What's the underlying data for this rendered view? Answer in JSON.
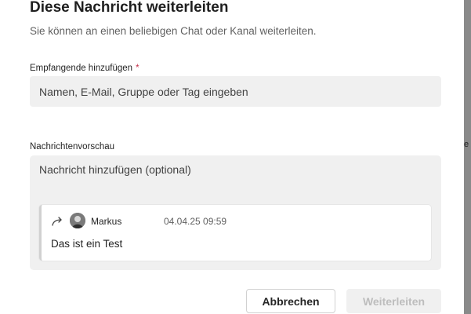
{
  "dialog": {
    "title": "Diese Nachricht weiterleiten",
    "subtitle": "Sie können an einen beliebigen Chat oder Kanal weiterleiten."
  },
  "recipients": {
    "label": "Empfangende hinzufügen",
    "required_marker": "*",
    "placeholder": "Namen, E-Mail, Gruppe oder Tag eingeben",
    "value": ""
  },
  "preview": {
    "label": "Nachrichtenvorschau",
    "message_placeholder": "Nachricht hinzufügen (optional)",
    "message_value": "",
    "quoted": {
      "icon": "forward-arrow-icon",
      "sender": "Markus",
      "timestamp": "04.04.25 09:59",
      "text": "Das ist ein Test"
    }
  },
  "actions": {
    "cancel_label": "Abbrechen",
    "forward_label": "Weiterleiten",
    "forward_enabled": false
  },
  "background": {
    "partial_text": "e"
  },
  "colors": {
    "required": "#c4314b",
    "disabled_text": "#bdbdbd",
    "field_background": "#f0f0f0"
  }
}
